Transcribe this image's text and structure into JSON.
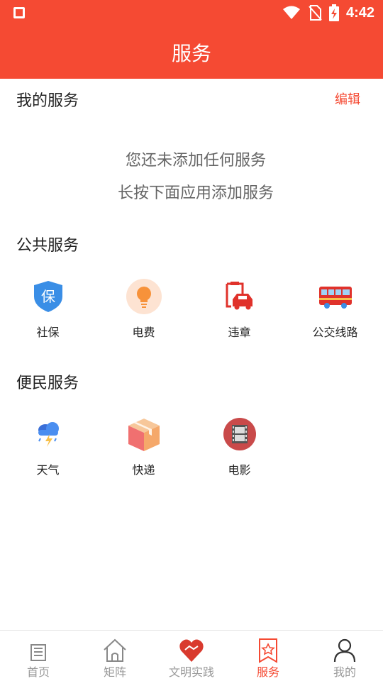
{
  "status_bar": {
    "time": "4:42"
  },
  "header": {
    "title": "服务"
  },
  "my_services": {
    "title": "我的服务",
    "edit_label": "编辑",
    "empty_line1": "您还未添加任何服务",
    "empty_line2": "长按下面应用添加服务"
  },
  "public_services": {
    "title": "公共服务",
    "items": [
      {
        "label": "社保",
        "icon": "social-security-shield-icon"
      },
      {
        "label": "电费",
        "icon": "lightbulb-icon"
      },
      {
        "label": "违章",
        "icon": "traffic-violation-car-icon"
      },
      {
        "label": "公交线路",
        "icon": "bus-icon"
      }
    ]
  },
  "convenience_services": {
    "title": "便民服务",
    "items": [
      {
        "label": "天气",
        "icon": "weather-storm-icon"
      },
      {
        "label": "快递",
        "icon": "package-box-icon"
      },
      {
        "label": "电影",
        "icon": "film-reel-icon"
      }
    ]
  },
  "tabbar": {
    "active": "服务",
    "tabs": [
      {
        "label": "首页",
        "icon": "newspaper-icon"
      },
      {
        "label": "矩阵",
        "icon": "house-icon"
      },
      {
        "label": "文明实践",
        "icon": "handshake-heart-icon"
      },
      {
        "label": "服务",
        "icon": "bookmark-star-icon"
      },
      {
        "label": "我的",
        "icon": "person-icon"
      }
    ]
  },
  "colors": {
    "brand": "#f54a33",
    "text": "#222222",
    "muted": "#999999"
  }
}
